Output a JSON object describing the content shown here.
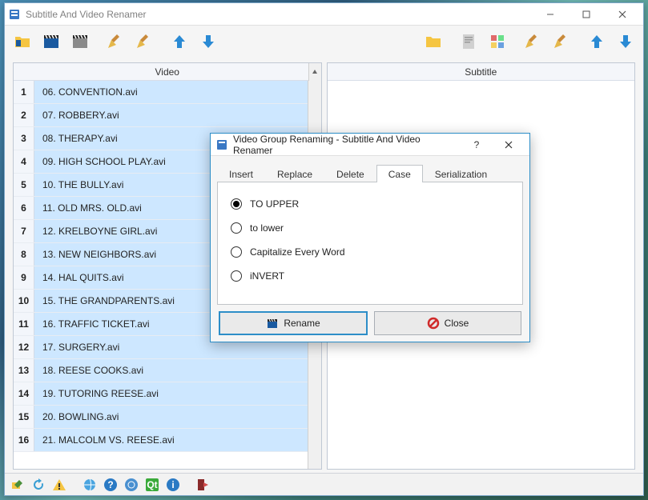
{
  "app": {
    "title": "Subtitle And Video Renamer"
  },
  "panels": {
    "left_header": "Video",
    "right_header": "Subtitle"
  },
  "videos": [
    {
      "n": "1",
      "name": "06. CONVENTION.avi"
    },
    {
      "n": "2",
      "name": "07. ROBBERY.avi"
    },
    {
      "n": "3",
      "name": "08. THERAPY.avi"
    },
    {
      "n": "4",
      "name": "09. HIGH SCHOOL PLAY.avi"
    },
    {
      "n": "5",
      "name": "10. THE BULLY.avi"
    },
    {
      "n": "6",
      "name": "11. OLD MRS. OLD.avi"
    },
    {
      "n": "7",
      "name": "12. KRELBOYNE GIRL.avi"
    },
    {
      "n": "8",
      "name": "13. NEW NEIGHBORS.avi"
    },
    {
      "n": "9",
      "name": "14. HAL QUITS.avi"
    },
    {
      "n": "10",
      "name": "15. THE GRANDPARENTS.avi"
    },
    {
      "n": "11",
      "name": "16. TRAFFIC TICKET.avi"
    },
    {
      "n": "12",
      "name": "17. SURGERY.avi"
    },
    {
      "n": "13",
      "name": "18. REESE COOKS.avi"
    },
    {
      "n": "14",
      "name": "19. TUTORING REESE.avi"
    },
    {
      "n": "15",
      "name": "20. BOWLING.avi"
    },
    {
      "n": "16",
      "name": "21. MALCOLM VS. REESE.avi"
    }
  ],
  "dialog": {
    "title": "Video Group Renaming - Subtitle And Video Renamer",
    "tabs": {
      "insert": "Insert",
      "replace": "Replace",
      "delete": "Delete",
      "case": "Case",
      "serialization": "Serialization"
    },
    "options": {
      "to_upper": "TO UPPER",
      "to_lower": "to lower",
      "capitalize": "Capitalize Every Word",
      "invert": "iNVERT"
    },
    "buttons": {
      "rename": "Rename",
      "close": "Close"
    }
  }
}
